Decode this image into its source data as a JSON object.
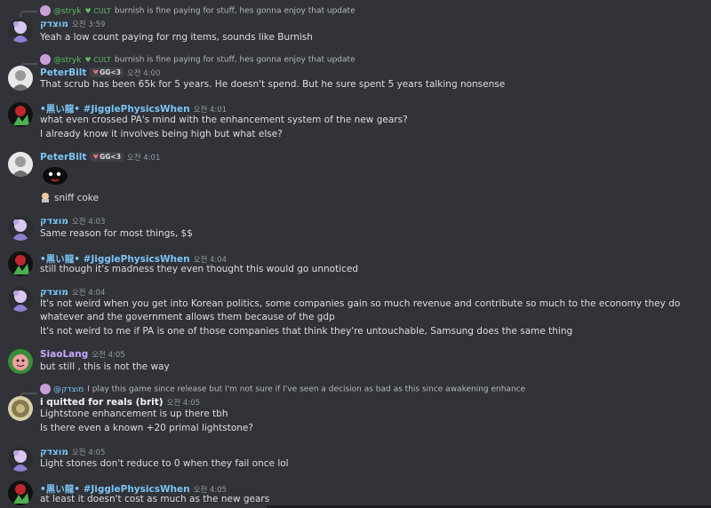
{
  "messages": [
    {
      "reply_user": "@stryk",
      "reply_tag": "CULT",
      "reply_text": "burnish is fine paying for stuff, hes gonna enjoy that update",
      "author": "מוצדק",
      "time": "오전 3:59",
      "lines": [
        "Yeah a low count paying for rng items, sounds like Burnish"
      ]
    },
    {
      "reply_user": "@stryk",
      "reply_tag": "CULT",
      "reply_text": "burnish is fine paying for stuff, hes gonna enjoy that update",
      "author": "PeterBilt",
      "tag": "GG<3",
      "time": "오전 4:00",
      "lines": [
        "That scrub has been 65k for 5 years. He doesn't spend. But he sure spent 5 years talking nonsense"
      ]
    },
    {
      "author": "•黒い龍• #JigglePhysicsWhen",
      "time": "오전 4:01",
      "lines": [
        "what even crossed PA's mind with the enhancement system of the new gears?",
        "I already know it involves being high but what else?"
      ]
    },
    {
      "author": "PeterBilt",
      "tag": "GG<3",
      "time": "오전 4:01",
      "lines": [
        "sniff coke"
      ]
    },
    {
      "author": "מוצדק",
      "time": "오전 4:03",
      "lines": [
        "Same reason for most things, $$"
      ]
    },
    {
      "author": "•黒い龍• #JigglePhysicsWhen",
      "time": "오전 4:04",
      "lines": [
        "still though it's madness they even thought this would go unnoticed"
      ]
    },
    {
      "author": "מוצדק",
      "time": "오전 4:04",
      "lines": [
        "It's not weird when you get into Korean politics, some companies gain so much revenue and contribute so much to the economy they do whatever and the government allows them because of the gdp",
        "It's not weird to me if PA is one of those companies that think they're untouchable, Samsung does the same thing"
      ]
    },
    {
      "author": "SiaoLang",
      "time": "오전 4:05",
      "lines": [
        "but still , this is not the way"
      ]
    },
    {
      "reply_user": "@מוצדק",
      "reply_text": "I play this game since release but I'm not sure if I've seen a decision as bad as this since awakening enhance",
      "author": "i quitted for reals (brit)",
      "time": "오전 4:05",
      "lines": [
        "Lightstone enhancement is up there tbh",
        "Is there even a known +20 primal lightstone?"
      ]
    },
    {
      "author": "מוצדק",
      "time": "오전 4:05",
      "lines": [
        "Light stones don't reduce to 0 when they fail once lol"
      ]
    },
    {
      "author": "•黒い龍• #JigglePhysicsWhen",
      "time": "오전 4:05",
      "lines": [
        "at least it doesn't cost as much as the new gears"
      ]
    }
  ],
  "icons": {
    "heart": "heart-icon",
    "emoji": "black-blob-emoji"
  },
  "colors": {
    "background": "#313338",
    "blue_name": "#7cc4f5",
    "purple_name": "#c9a6ff",
    "cult_green": "#5dbb63"
  }
}
